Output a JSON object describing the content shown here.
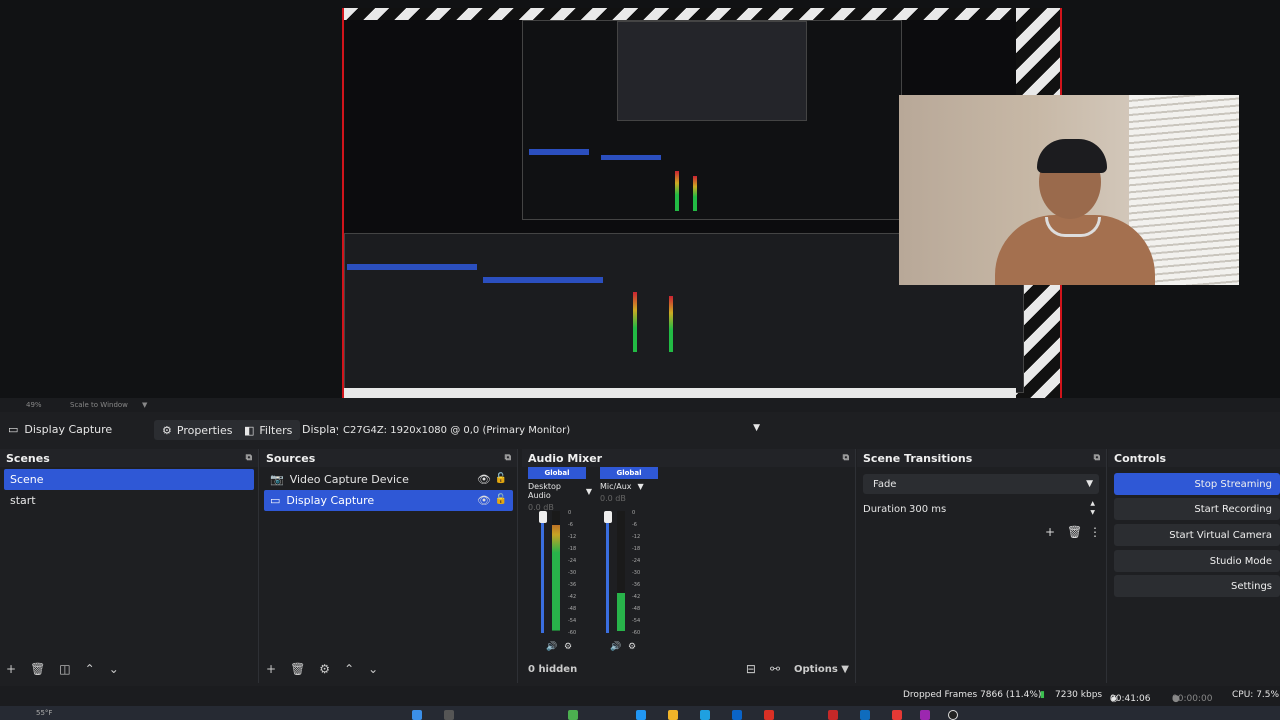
{
  "preview": {
    "bar_zoom": "49%",
    "bar_scale": "Scale to Window"
  },
  "context": {
    "source_label": "Display Capture",
    "properties_label": "Properties",
    "filters_label": "Filters",
    "display_label": "Display",
    "display_value": "C27G4Z: 1920x1080 @ 0,0 (Primary Monitor)"
  },
  "scenes": {
    "title": "Scenes",
    "items": [
      "Scene",
      "start"
    ]
  },
  "sources": {
    "title": "Sources",
    "items": [
      "Video Capture Device",
      "Display Capture"
    ]
  },
  "mixer": {
    "title": "Audio Mixer",
    "channels": [
      {
        "global": "Global",
        "name": "Desktop Audio",
        "db": "0.0 dB",
        "level": 0.88
      },
      {
        "global": "Global",
        "name": "Mic/Aux",
        "db": "0.0 dB",
        "level": 0.32
      }
    ],
    "scale": [
      "0",
      "-6",
      "-12",
      "-18",
      "-24",
      "-30",
      "-36",
      "-42",
      "-48",
      "-54",
      "-60"
    ],
    "hidden": "0 hidden",
    "options_label": "Options"
  },
  "transitions": {
    "title": "Scene Transitions",
    "type": "Fade",
    "duration_label": "Duration",
    "duration_value": "300 ms"
  },
  "controls": {
    "title": "Controls",
    "buttons": [
      "Stop Streaming",
      "Start Recording",
      "Start Virtual Camera",
      "Studio Mode",
      "Settings"
    ]
  },
  "status": {
    "dropped": "Dropped Frames 7866 (11.4%)",
    "kbps": "7230 kbps",
    "stream_time": "00:41:06",
    "rec_time": "00:00:00",
    "cpu": "CPU: 7.5%"
  },
  "taskbar": {
    "weather": "55°F"
  },
  "colors": {
    "accent": "#2f58d6",
    "canvas_border": "#d1141b"
  }
}
